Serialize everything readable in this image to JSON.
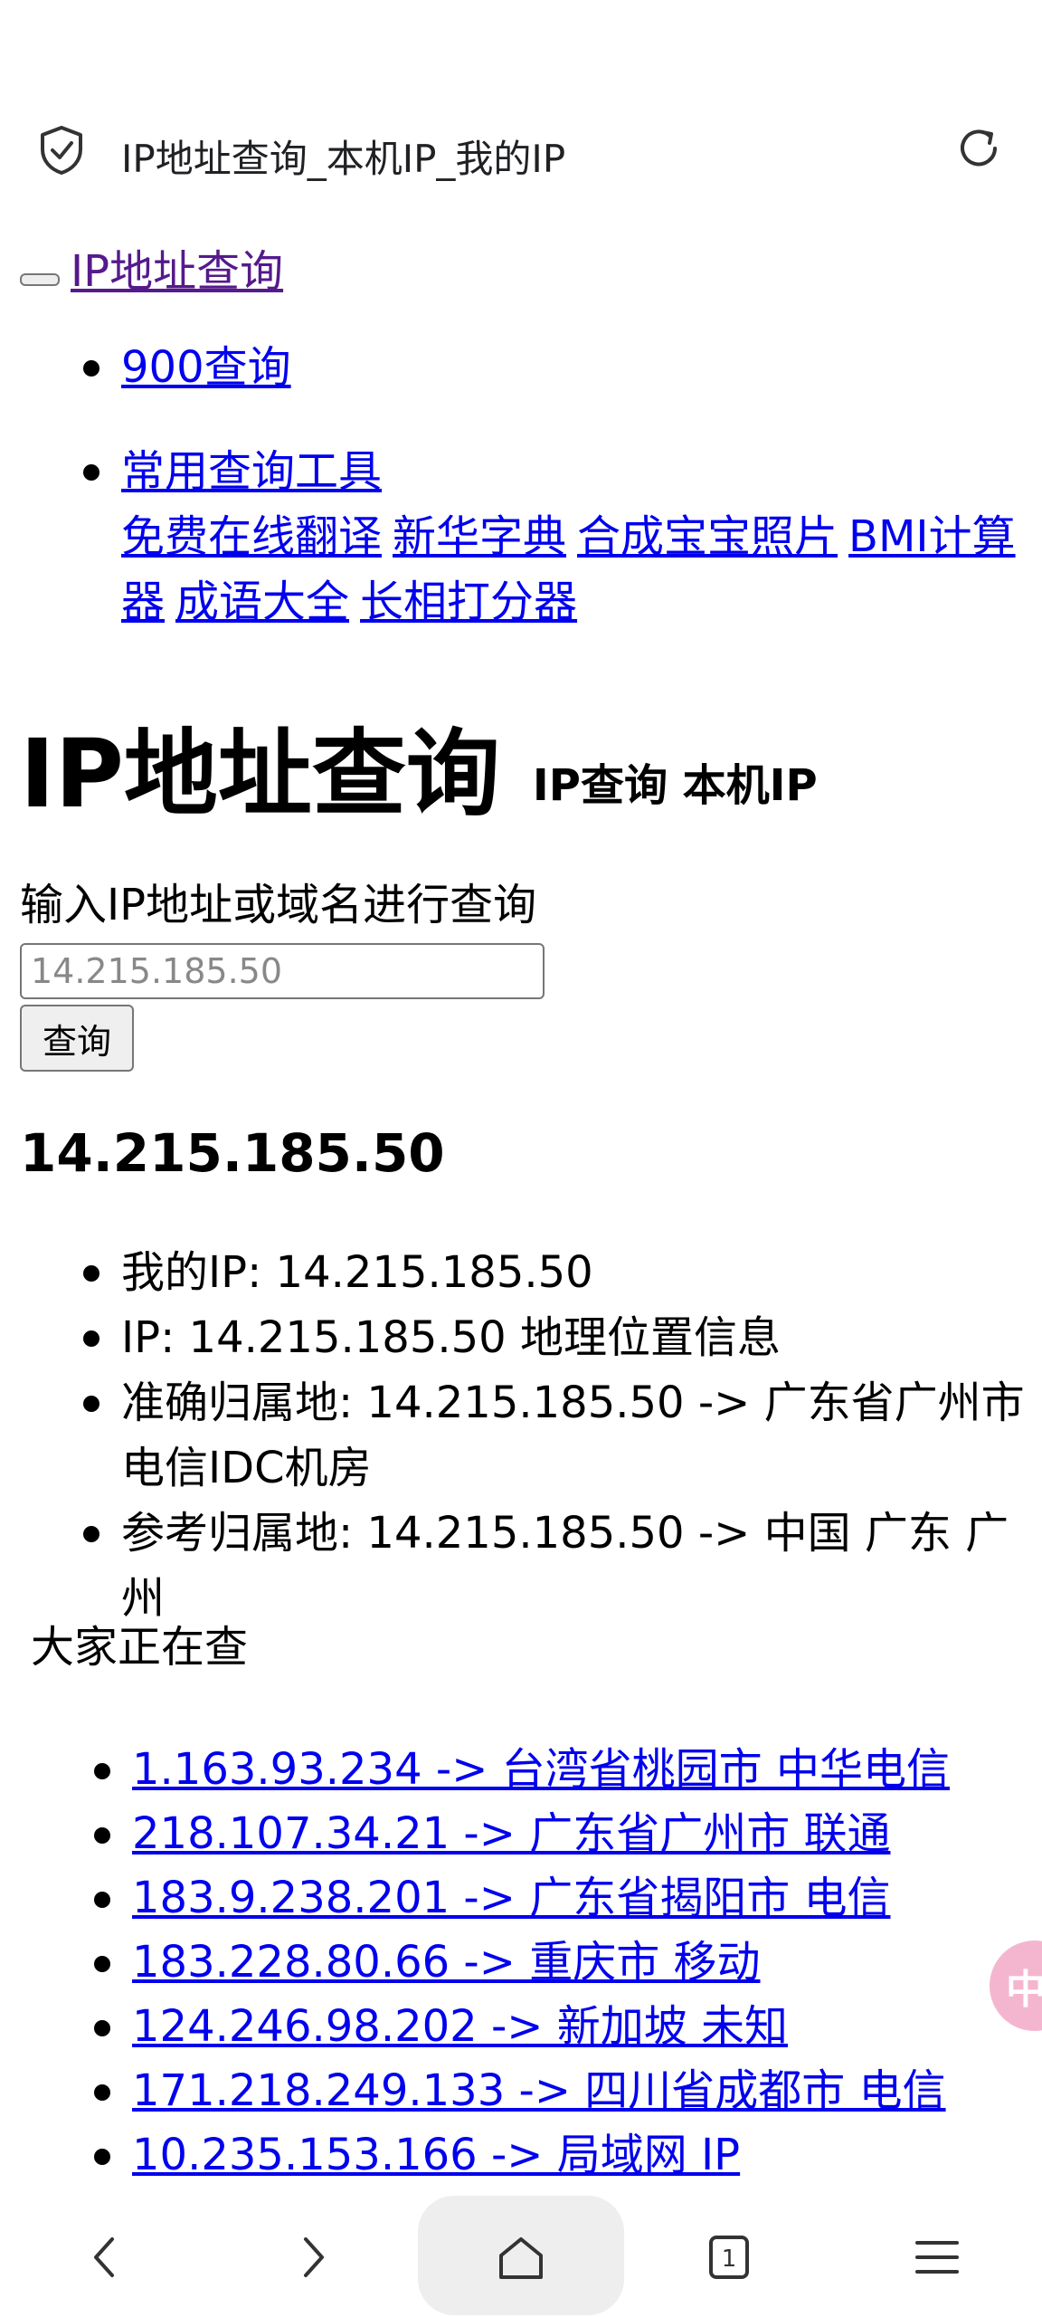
{
  "browser": {
    "title": "IP地址查询_本机IP_我的IP"
  },
  "site": {
    "link": "IP地址查询"
  },
  "nav": {
    "item1": "900查询",
    "item2": "常用查询工具",
    "tools": [
      "免费在线翻译",
      "新华字典",
      "合成宝宝照片",
      "BMI计算器",
      "成语大全",
      "长相打分器"
    ]
  },
  "heading": {
    "title": "IP地址查询",
    "subtitle": "IP查询 本机IP"
  },
  "query": {
    "label": "输入IP地址或域名进行查询",
    "placeholder": "14.215.185.50",
    "button": "查询"
  },
  "result": {
    "ip": "14.215.185.50",
    "lines": [
      "我的IP: 14.215.185.50",
      "IP: 14.215.185.50 地理位置信息",
      "准确归属地: 14.215.185.50 -> 广东省广州市电信IDC机房",
      "参考归属地: 14.215.185.50 -> 中国 广东 广州"
    ]
  },
  "hot": {
    "label": "大家正在查",
    "links": [
      "1.163.93.234 -> 台湾省桃园市 中华电信",
      "218.107.34.21 -> 广东省广州市 联通",
      "183.9.238.201 -> 广东省揭阳市 电信",
      "183.228.80.66 -> 重庆市 移动",
      "124.246.98.202 -> 新加坡 未知",
      "171.218.249.133 -> 四川省成都市 电信",
      "10.235.153.166 -> 局域网 IP"
    ]
  },
  "float_badge": "中",
  "bottom_nav": {
    "tab_count": "1"
  },
  "icons": {
    "shield": "shield-check-icon",
    "reload": "reload-icon",
    "back": "back-icon",
    "forward": "forward-icon",
    "home": "home-icon",
    "tabs": "tabs-icon",
    "menu": "menu-icon"
  }
}
